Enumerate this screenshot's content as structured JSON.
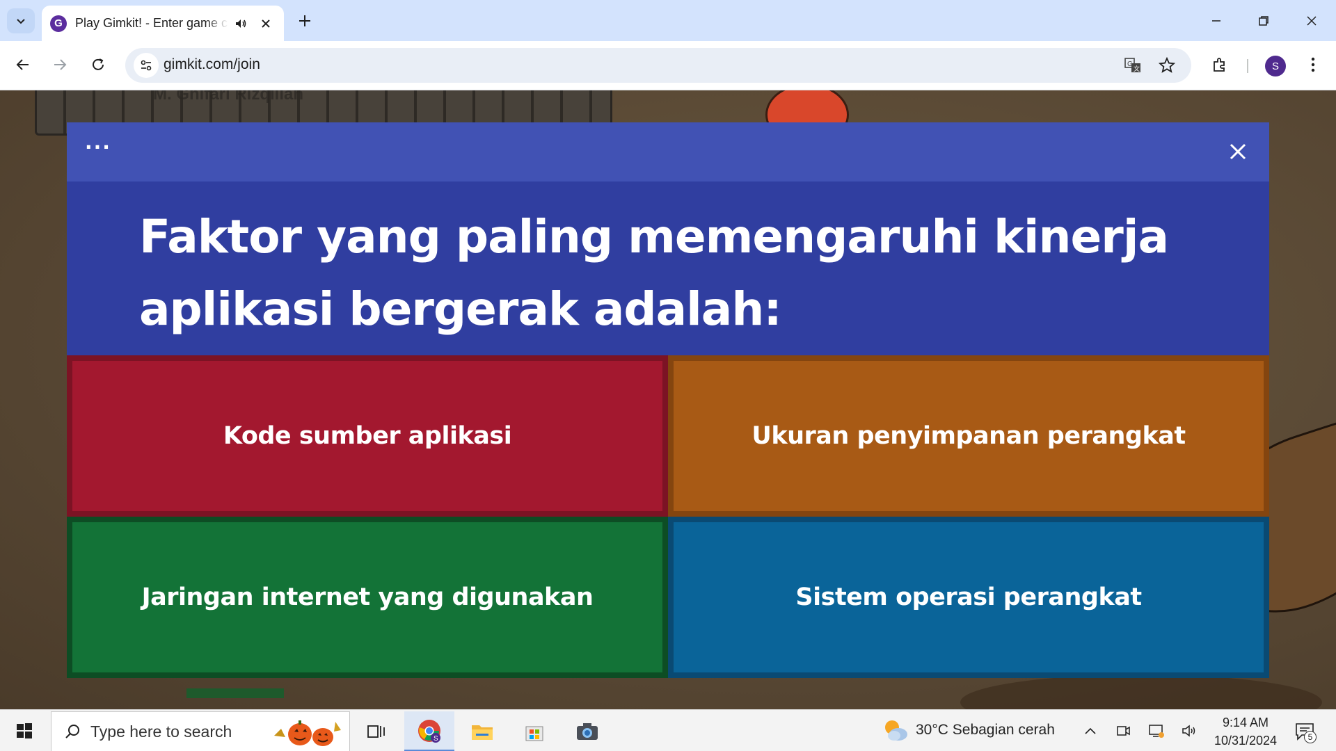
{
  "browser": {
    "tab": {
      "title": "Play Gimkit! - Enter game code",
      "favicon_letter": "G"
    },
    "address": {
      "url": "gimkit.com/join"
    },
    "profile_initial": "S"
  },
  "question": {
    "text": "Faktor yang paling memengaruhi kinerja aplikasi bergerak adalah:",
    "answers": [
      {
        "label": "Kode sumber aplikasi",
        "color": "#a3182f"
      },
      {
        "label": "Ukuran penyimpanan perangkat",
        "color": "#a85a15"
      },
      {
        "label": "Jaringan internet yang digunakan",
        "color": "#137337"
      },
      {
        "label": "Sistem operasi perangkat",
        "color": "#0a6499"
      }
    ],
    "menu_icon": "more-dots-icon",
    "close_icon": "close-icon"
  },
  "background": {
    "player_name": "M. Ghifari Rizqillah"
  },
  "taskbar": {
    "search_placeholder": "Type here to search",
    "weather": "30°C  Sebagian cerah",
    "time": "9:14 AM",
    "date": "10/31/2024",
    "notification_count": "5"
  }
}
